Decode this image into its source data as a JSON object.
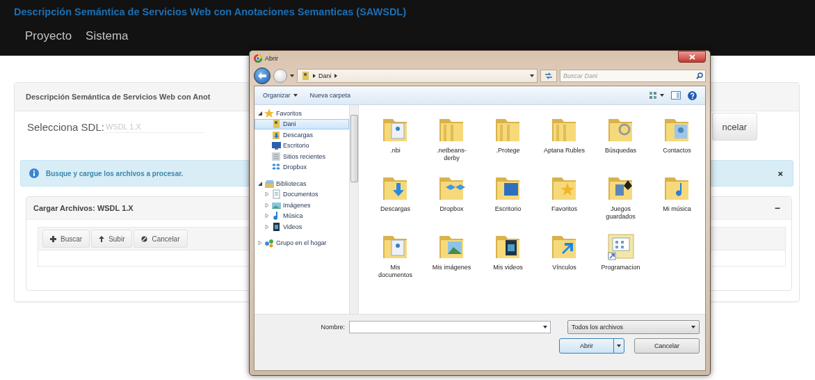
{
  "app": {
    "title": "Descripción Semántica de Servicios Web con Anotaciones Semanticas (SAWSDL)",
    "menu": [
      {
        "label": "Proyecto"
      },
      {
        "label": "Sistema"
      }
    ]
  },
  "main_panel": {
    "heading": "Descripción Semántica de Servicios Web con Anot",
    "sdl_label": "Selecciona SDL:",
    "sdl_field": {
      "placeholder": "WSDL 1.X"
    },
    "cancel_button": "ncelar",
    "alert": {
      "message": "Busque y cargue los archivos a procesar.",
      "close": "×"
    },
    "upload_panel": {
      "title": "Cargar Archivos: WSDL 1.X",
      "collapse": "−",
      "buttons": [
        {
          "kind": "add",
          "label": "Buscar"
        },
        {
          "kind": "upload",
          "label": "Subir"
        },
        {
          "kind": "cancel",
          "label": "Cancelar"
        }
      ]
    }
  },
  "dialog": {
    "title": "Abrir",
    "breadcrumb": [
      "Dani"
    ],
    "search": {
      "placeholder": "Buscar Dani"
    },
    "toolbar": [
      "Organizar",
      "Nueva carpeta"
    ],
    "nav": [
      {
        "label": "Favoritos",
        "kind": "star",
        "expanded": true,
        "selected": false,
        "children": [
          {
            "label": "Dani",
            "kind": "user",
            "selected": true
          },
          {
            "label": "Descargas",
            "kind": "download",
            "selected": false
          },
          {
            "label": "Escritorio",
            "kind": "desktop",
            "selected": false
          },
          {
            "label": "Sitios recientes",
            "kind": "recent",
            "selected": false
          },
          {
            "label": "Dropbox",
            "kind": "dropbox",
            "selected": false
          }
        ]
      },
      {
        "label": "Bibliotecas",
        "kind": "library",
        "expanded": true,
        "selected": false,
        "children": [
          {
            "label": "Documentos",
            "kind": "document",
            "expanded": false,
            "selected": false
          },
          {
            "label": "Imágenes",
            "kind": "image",
            "expanded": false,
            "selected": false
          },
          {
            "label": "Música",
            "kind": "music",
            "expanded": false,
            "selected": false
          },
          {
            "label": "Videos",
            "kind": "video",
            "expanded": false,
            "selected": false
          }
        ]
      },
      {
        "label": "Grupo en el hogar",
        "kind": "homegroup",
        "expanded": false,
        "selected": false
      }
    ],
    "files": [
      {
        "name": ".nbi",
        "kind": "document"
      },
      {
        "name": ".netbeans-derby",
        "kind": "plain"
      },
      {
        "name": ".Protege",
        "kind": "plain"
      },
      {
        "name": "Aptana Rubles",
        "kind": "plain"
      },
      {
        "name": "Búsquedas",
        "kind": "search"
      },
      {
        "name": "Contactos",
        "kind": "contact"
      },
      {
        "name": "Descargas",
        "kind": "download"
      },
      {
        "name": "Dropbox",
        "kind": "dropbox"
      },
      {
        "name": "Escritorio",
        "kind": "desktop"
      },
      {
        "name": "Favoritos",
        "kind": "star"
      },
      {
        "name": "Juegos guardados",
        "kind": "games"
      },
      {
        "name": "Mi música",
        "kind": "music"
      },
      {
        "name": "Mis documentos",
        "kind": "document"
      },
      {
        "name": "Mis imágenes",
        "kind": "image"
      },
      {
        "name": "Mis videos",
        "kind": "video"
      },
      {
        "name": "Vínculos",
        "kind": "link"
      },
      {
        "name": "Programacion",
        "kind": "shortcut"
      }
    ],
    "name_label": "Nombre:",
    "filter": "Todos los archivos",
    "buttons": [
      "Abrir",
      "Cancelar"
    ]
  }
}
